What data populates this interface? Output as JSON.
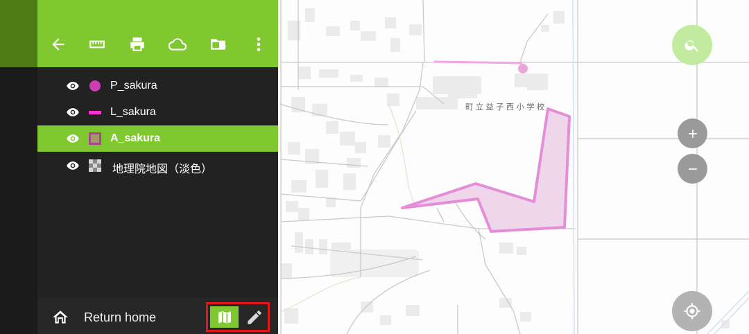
{
  "toolbar": {
    "icons": [
      "arrow-back-icon",
      "ruler-icon",
      "print-icon",
      "cloud-icon",
      "folder-settings-icon",
      "more-vert-icon"
    ]
  },
  "layers": [
    {
      "name": "P_sakura",
      "symbol": "point",
      "color": "#cc3fb4",
      "visible": true,
      "selected": false
    },
    {
      "name": "L_sakura",
      "symbol": "line",
      "color": "#ff2fd0",
      "visible": true,
      "selected": false
    },
    {
      "name": "A_sakura",
      "symbol": "polygon",
      "color": "#a8468f",
      "visible": true,
      "selected": true
    },
    {
      "name": "地理院地図（淡色）",
      "symbol": "tile",
      "color": "#9a9a9a",
      "visible": true,
      "selected": false
    }
  ],
  "bottom_bar": {
    "home_label": "Return home",
    "modes": [
      {
        "name": "map-mode",
        "active": true
      },
      {
        "name": "edit-mode",
        "active": false
      }
    ]
  },
  "map": {
    "place_label": "町立益子西小学校"
  },
  "colors": {
    "accent": "#7fc82f",
    "drawer_bg": "#222222",
    "highlight_border": "#e3161b",
    "feature_stroke": "#e48ed7",
    "feature_fill": "#f0d6ea"
  }
}
